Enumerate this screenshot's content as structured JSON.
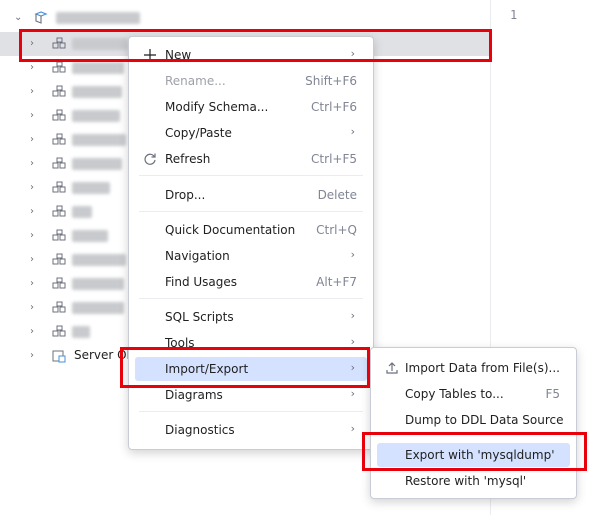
{
  "editor": {
    "line_numbers": [
      "1"
    ]
  },
  "tree": {
    "rows": [
      {
        "name": "root-connection",
        "blur": true,
        "selected": false
      },
      {
        "name": "schema-1",
        "blur": true,
        "selected": true
      },
      {
        "name": "schema-2",
        "blur": true,
        "selected": false
      },
      {
        "name": "schema-3",
        "blur": true,
        "selected": false
      },
      {
        "name": "schema-4",
        "blur": true,
        "selected": false
      },
      {
        "name": "schema-5",
        "blur": true,
        "selected": false
      },
      {
        "name": "schema-6",
        "blur": true,
        "selected": false
      },
      {
        "name": "schema-7",
        "blur": true,
        "selected": false
      },
      {
        "name": "schema-8",
        "blur": true,
        "selected": false
      },
      {
        "name": "schema-9",
        "blur": true,
        "selected": false
      },
      {
        "name": "schema-10",
        "blur": true,
        "selected": false
      },
      {
        "name": "schema-11",
        "blur": true,
        "selected": false
      },
      {
        "name": "schema-12",
        "blur": true,
        "selected": false
      },
      {
        "name": "schema-13",
        "blur": true,
        "selected": false
      }
    ],
    "server_objects_label": "Server Ob"
  },
  "context_menu": {
    "items": [
      {
        "label": "New",
        "shortcut": "",
        "submenu": true,
        "disabled": false,
        "icon": "plus-icon"
      },
      {
        "label": "Rename...",
        "shortcut": "Shift+F6",
        "submenu": false,
        "disabled": true,
        "icon": ""
      },
      {
        "label": "Modify Schema...",
        "shortcut": "Ctrl+F6",
        "submenu": false,
        "disabled": false,
        "icon": ""
      },
      {
        "label": "Copy/Paste",
        "shortcut": "",
        "submenu": true,
        "disabled": false,
        "icon": ""
      },
      {
        "label": "Refresh",
        "shortcut": "Ctrl+F5",
        "submenu": false,
        "disabled": false,
        "icon": "refresh-icon"
      },
      {
        "label": "Drop...",
        "shortcut": "Delete",
        "submenu": false,
        "disabled": false,
        "icon": ""
      },
      {
        "label": "Quick Documentation",
        "shortcut": "Ctrl+Q",
        "submenu": false,
        "disabled": false,
        "icon": ""
      },
      {
        "label": "Navigation",
        "shortcut": "",
        "submenu": true,
        "disabled": false,
        "icon": ""
      },
      {
        "label": "Find Usages",
        "shortcut": "Alt+F7",
        "submenu": false,
        "disabled": false,
        "icon": ""
      },
      {
        "label": "SQL Scripts",
        "shortcut": "",
        "submenu": true,
        "disabled": false,
        "icon": ""
      },
      {
        "label": "Tools",
        "shortcut": "",
        "submenu": true,
        "disabled": false,
        "icon": ""
      },
      {
        "label": "Import/Export",
        "shortcut": "",
        "submenu": true,
        "disabled": false,
        "icon": "",
        "highlighted": true
      },
      {
        "label": "Diagrams",
        "shortcut": "",
        "submenu": true,
        "disabled": false,
        "icon": ""
      },
      {
        "label": "Diagnostics",
        "shortcut": "",
        "submenu": true,
        "disabled": false,
        "icon": ""
      }
    ]
  },
  "submenu": {
    "items": [
      {
        "label": "Import Data from File(s)...",
        "shortcut": "",
        "icon": "import-icon"
      },
      {
        "label": "Copy Tables to...",
        "shortcut": "F5",
        "icon": ""
      },
      {
        "label": "Dump to DDL Data Source",
        "shortcut": "",
        "icon": ""
      },
      {
        "label": "Export with 'mysqldump'",
        "shortcut": "",
        "icon": "",
        "highlighted": true
      },
      {
        "label": "Restore with 'mysql'",
        "shortcut": "",
        "icon": ""
      }
    ]
  },
  "colors": {
    "highlight_red": "#e8000b",
    "menu_highlight": "#d4e2ff",
    "selection": "#dfe1e5"
  }
}
